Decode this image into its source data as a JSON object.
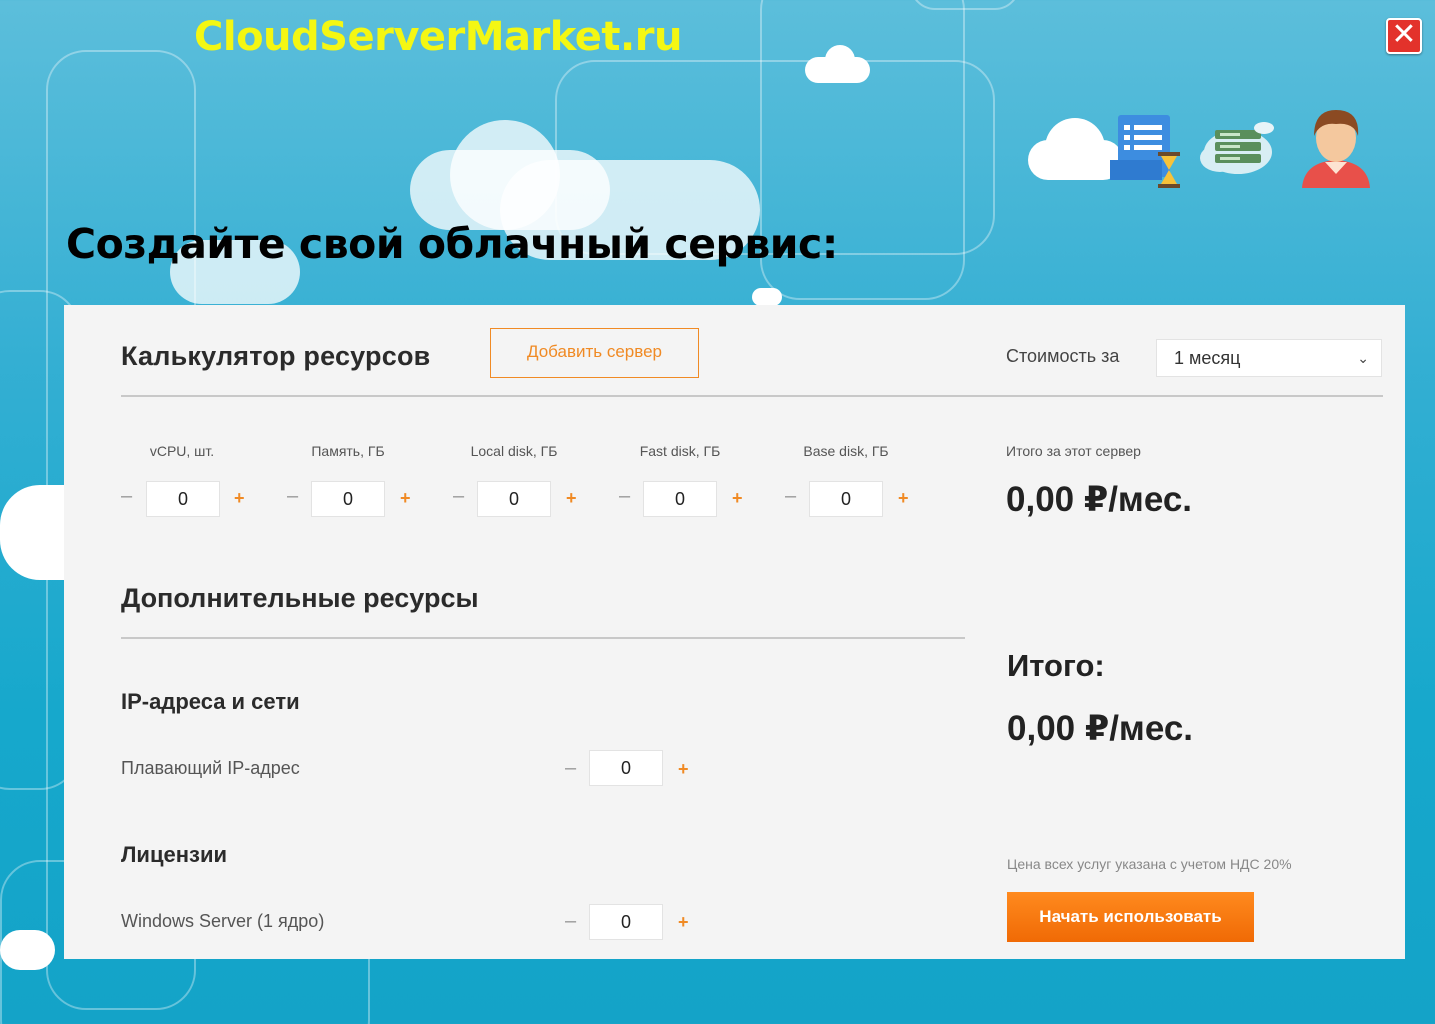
{
  "header": {
    "site_title": "CloudServerMarket.ru",
    "close_label": "✕",
    "hero_title": "Создайте свой облачный сервис:"
  },
  "calculator": {
    "title": "Калькулятор ресурсов",
    "add_server_label": "Добавить сервер",
    "cost_label": "Стоимость за",
    "period_value": "1 месяц",
    "resources": [
      {
        "label": "vCPU, шт.",
        "value": "0"
      },
      {
        "label": "Память, ГБ",
        "value": "0"
      },
      {
        "label": "Local disk, ГБ",
        "value": "0"
      },
      {
        "label": "Fast disk, ГБ",
        "value": "0"
      },
      {
        "label": "Base disk, ГБ",
        "value": "0"
      }
    ],
    "minus_glyph": "–",
    "plus_glyph": "+",
    "server_total_label": "Итого за этот сервер",
    "server_total_value": "0,00 ₽/мес."
  },
  "extra": {
    "title": "Дополнительные ресурсы",
    "ip_section_title": "IP-адреса и сети",
    "floating_ip_label": "Плавающий IP-адрес",
    "floating_ip_value": "0",
    "licenses_title": "Лицензии",
    "windows_label": "Windows Server (1 ядро)",
    "windows_value": "0"
  },
  "summary": {
    "total_label": "Итого:",
    "total_value": "0,00 ₽/мес.",
    "vat_note": "Цена всех услуг указана с учетом НДС 20%",
    "start_label": "Начать использовать"
  },
  "colors": {
    "accent": "#f08a24",
    "site_title": "#f4f713",
    "background": "#14a3c8",
    "panel": "#f4f4f4"
  },
  "icons": [
    "close-icon",
    "document-hourglass-icon",
    "server-cloud-icon",
    "user-avatar-icon",
    "chevron-down-icon"
  ]
}
